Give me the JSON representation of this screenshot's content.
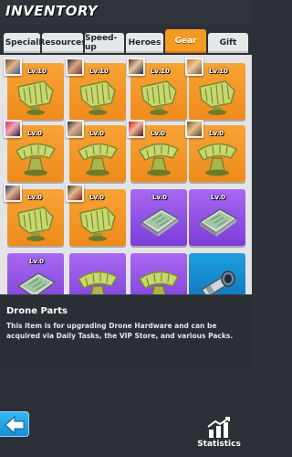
{
  "header": {
    "title": "INVENTORY"
  },
  "tabs": [
    {
      "label": "Special"
    },
    {
      "label": "Resources"
    },
    {
      "label": "Speed-up"
    },
    {
      "label": "Heroes"
    },
    {
      "label": "Gear",
      "active": true
    },
    {
      "label": "Gift"
    }
  ],
  "items": [
    {
      "level": "Lv.10",
      "rarity": "orange",
      "icon": "drone-wing-icon",
      "hero": true
    },
    {
      "level": "Lv.10",
      "rarity": "orange",
      "icon": "drone-wing-icon",
      "hero": true
    },
    {
      "level": "Lv.10",
      "rarity": "orange",
      "icon": "drone-wing-icon",
      "hero": true
    },
    {
      "level": "Lv.10",
      "rarity": "orange",
      "icon": "drone-wing-icon",
      "hero": true
    },
    {
      "level": "Lv.0",
      "rarity": "orange",
      "icon": "drone-stand-icon",
      "hero": true
    },
    {
      "level": "Lv.0",
      "rarity": "orange",
      "icon": "drone-stand-icon",
      "hero": true
    },
    {
      "level": "Lv.0",
      "rarity": "orange",
      "icon": "drone-stand-icon",
      "hero": true
    },
    {
      "level": "Lv.0",
      "rarity": "orange",
      "icon": "drone-stand-icon",
      "hero": true
    },
    {
      "level": "Lv.0",
      "rarity": "orange",
      "icon": "drone-wing-icon",
      "hero": true
    },
    {
      "level": "Lv.0",
      "rarity": "orange",
      "icon": "drone-wing-icon",
      "hero": true
    },
    {
      "level": "Lv.0",
      "rarity": "purple",
      "icon": "drone-panel-icon",
      "hero": false
    },
    {
      "level": "Lv.0",
      "rarity": "purple",
      "icon": "drone-panel-icon",
      "hero": false
    },
    {
      "level": "Lv.0",
      "rarity": "purple",
      "icon": "drone-panel-icon",
      "hero": false
    },
    {
      "level": "",
      "rarity": "purple",
      "icon": "drone-stand-icon",
      "hero": false
    },
    {
      "level": "",
      "rarity": "purple",
      "icon": "drone-stand-icon",
      "hero": false
    },
    {
      "level": "",
      "rarity": "blue",
      "icon": "drone-scope-icon",
      "hero": false
    }
  ],
  "description": {
    "name": "Drone Parts",
    "text": "This item is for upgrading Drone Hardware and can be acquired via Daily Tasks, the VIP Store, and various Packs."
  },
  "bottom": {
    "back_icon": "arrow-left-icon",
    "stats_icon": "bar-chart-icon",
    "stats_label": "Statistics"
  },
  "colors": {
    "orange": "#f49a21",
    "purple": "#8c4ae2",
    "blue": "#1a8fd2",
    "accent": "#1b8cd2"
  }
}
